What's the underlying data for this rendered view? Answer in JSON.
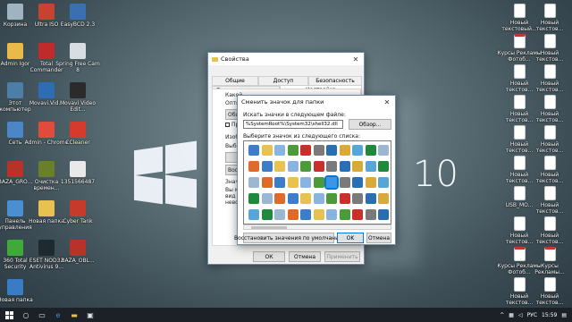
{
  "desktop": {
    "left_icons": [
      {
        "label": "Корзина",
        "icon": "recycle-bin-icon",
        "color": "#9fb4c0"
      },
      {
        "label": "Ultra ISO",
        "icon": "ultraiso-icon",
        "color": "#c8432f"
      },
      {
        "label": "EasyBCD 2.3",
        "icon": "easybcd-icon",
        "color": "#3a6fb0"
      },
      {
        "label": "Admin Igor",
        "icon": "user-folder-icon",
        "color": "#e9b94a"
      },
      {
        "label": "Total Commander",
        "icon": "total-commander-icon",
        "color": "#c02a2a"
      },
      {
        "label": "Spring Free Cam 8",
        "icon": "freecam-icon",
        "color": "#d8dde2"
      },
      {
        "label": "Этот компьютер",
        "icon": "computer-icon",
        "color": "#4d7ea8"
      },
      {
        "label": "Movavi.Vid...",
        "icon": "movavi-icon",
        "color": "#2d6db5"
      },
      {
        "label": "Movavi Video Edit...",
        "icon": "movavi-editor-icon",
        "color": "#2b2b2b"
      },
      {
        "label": "Сеть",
        "icon": "network-icon",
        "color": "#4b86c6"
      },
      {
        "label": "Admin - Chrome",
        "icon": "chrome-icon",
        "color": "#e14b3b"
      },
      {
        "label": "CCleaner",
        "icon": "ccleaner-icon",
        "color": "#d63a2c"
      },
      {
        "label": "BAZA_GRO...",
        "icon": "image-file-icon",
        "color": "#b7332a"
      },
      {
        "label": "Очистка времен...",
        "icon": "cleanup-icon",
        "color": "#6a7f2a"
      },
      {
        "label": "1351566487",
        "icon": "file-icon",
        "color": "#e9e9e9"
      },
      {
        "label": "Панель управления",
        "icon": "control-panel-icon",
        "color": "#4a8fd0"
      },
      {
        "label": "Новая папка",
        "icon": "folder-icon",
        "color": "#e7c24f"
      },
      {
        "label": "Cyber Tank",
        "icon": "cybertank-icon",
        "color": "#c53a2a"
      },
      {
        "label": "360 Total Security",
        "icon": "shield-icon",
        "color": "#3faa3a"
      },
      {
        "label": "ESET NOD32 Antivirus 9...",
        "icon": "eset-icon",
        "color": "#1e2a30"
      },
      {
        "label": "BAZA_OBL...",
        "icon": "image-file-icon",
        "color": "#b7332a"
      },
      {
        "label": "Новая папка",
        "icon": "folder-icon",
        "color": "#3a7cc4"
      }
    ],
    "right_icons": [
      {
        "label": "Новый текстовый...",
        "icon": "text-file-icon"
      },
      {
        "label": "Новый текстов...",
        "icon": "text-file-icon"
      },
      {
        "label": "Курсы Рекламы Фотоб...",
        "icon": "pdf-file-icon"
      },
      {
        "label": "Новый текстов...",
        "icon": "text-file-icon"
      },
      {
        "label": "Новый текстов...",
        "icon": "text-file-icon"
      },
      {
        "label": "Новый текстов...",
        "icon": "text-file-icon"
      },
      {
        "label": "Новый текстов...",
        "icon": "text-file-icon"
      },
      {
        "label": "Новый текстов...",
        "icon": "text-file-icon"
      },
      {
        "label": "Новый текстов...",
        "icon": "text-file-icon"
      },
      {
        "label": "Новый текстов...",
        "icon": "text-file-icon"
      },
      {
        "label": "Новый текстов...",
        "icon": "text-file-icon"
      },
      {
        "label": "Новый текстов...",
        "icon": "text-file-icon"
      },
      {
        "label": "USB_MO...",
        "icon": "text-file-icon"
      },
      {
        "label": "Новый текстов...",
        "icon": "text-file-icon"
      },
      {
        "label": "Новый текстов...",
        "icon": "text-file-icon"
      },
      {
        "label": "Новый текстов...",
        "icon": "text-file-icon"
      },
      {
        "label": "Курсы Рекламы Фотоб...",
        "icon": "pdf-file-icon"
      },
      {
        "label": "Курсы Рекламы...",
        "icon": "pdf-file-icon"
      },
      {
        "label": "Новый текстов...",
        "icon": "text-file-icon"
      },
      {
        "label": "Новый текстов...",
        "icon": "text-file-icon"
      }
    ],
    "wallpaper_text": "10"
  },
  "properties_dialog": {
    "title": "Свойства",
    "tabs_row1": [
      "Общие",
      "Доступ",
      "Безопасность"
    ],
    "tabs_row2": [
      "Предыдущие версии",
      "Настройка"
    ],
    "fragments": [
      "Какой",
      "Оптими",
      "Общие",
      "При",
      "Изобр",
      "Выбер",
      "Восс",
      "Значки",
      "Вы мож",
      "вид за",
      "невозм"
    ],
    "ok": "ОК",
    "cancel": "Отмена",
    "apply": "Применить"
  },
  "change_icon_dialog": {
    "title": "Сменить значок для папки",
    "search_label": "Искать значки в следующем файле:",
    "file_path": "%SystemRoot%\\System32\\shell32.dll",
    "browse": "Обзор...",
    "select_label": "Выберите значок из следующего списка:",
    "restore_defaults": "Восстановить значения по умолчанию",
    "ok": "OK",
    "cancel": "Отмена"
  },
  "taskbar": {
    "lang": "РУС",
    "time": "15:59"
  },
  "colors": {
    "accent": "#0078d7",
    "taskbar": "#1b2126"
  }
}
